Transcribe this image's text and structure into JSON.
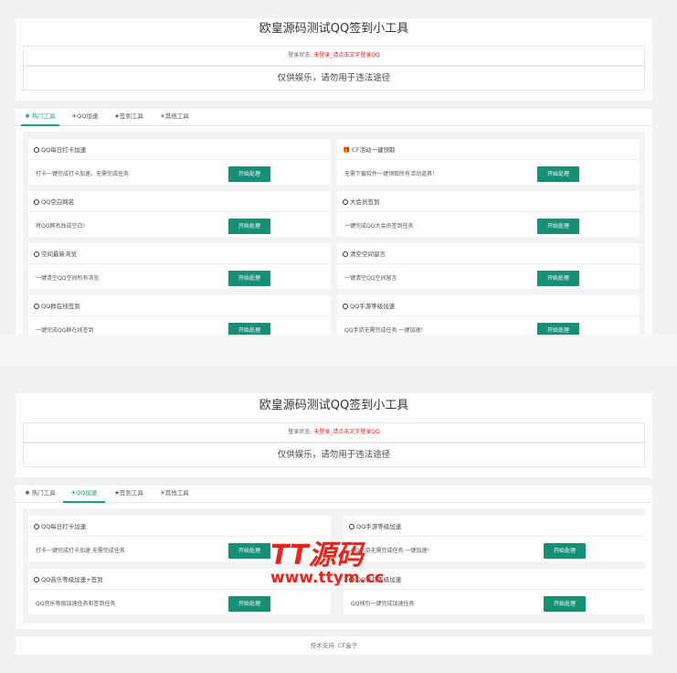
{
  "top": {
    "title": "欧皇源码测试QQ签到小工具",
    "status_prefix": "登录状态:",
    "status_value": "未登录_请点击文字登录QQ",
    "notice": "仅供娱乐，请勿用于违法途径",
    "tabs": [
      "热门工具",
      "QQ加速",
      "签到工具",
      "其他工具"
    ],
    "active_tab": 0,
    "cards": [
      {
        "title": "QQ每日打卡加速",
        "desc": "打卡一键完成打卡加速，无需完成任务",
        "button": "开始处理"
      },
      {
        "title": "CF活动一键领取",
        "desc": "无需下载软件一键领取所有活动道具！",
        "button": "开始处理"
      },
      {
        "title": "QQ空白网名",
        "desc": "将QQ网名改成空白！",
        "button": "开始处理"
      },
      {
        "title": "大会员签到",
        "desc": "一键完成QQ大会员签到任务",
        "button": "开始处理"
      },
      {
        "title": "空间最新浏览",
        "desc": "一键清空QQ空间所有浏览",
        "button": "开始处理"
      },
      {
        "title": "清空空间留言",
        "desc": "一键清空QQ空间留言",
        "button": "开始处理"
      },
      {
        "title": "QQ群在线签到",
        "desc": "一键完成QQ群在线签到",
        "button": "开始处理"
      },
      {
        "title": "QQ手游等级加速",
        "desc": "QQ手游无需完成任务 一键加速！",
        "button": "开始处理"
      }
    ]
  },
  "bottom": {
    "title": "欧皇源码测试QQ签到小工具",
    "status_prefix": "登录状态:",
    "status_value": "未登录_请点击文字登录QQ",
    "notice": "仅供娱乐，请勿用于违法途径",
    "tabs": [
      "热门工具",
      "QQ加速",
      "签到工具",
      "其他工具"
    ],
    "active_tab": 1,
    "cards": [
      {
        "title": "QQ每日打卡加速",
        "desc": "打卡一键完成打卡加速 无需完成任务",
        "button": "开始处理"
      },
      {
        "title": "QQ手游等级加速",
        "desc": "QQ手游无需完成任务 一键加速！",
        "button": "开始处理"
      },
      {
        "title": "QQ音乐等级加速+签到",
        "desc": "QQ音乐等级加速任务和签到任务",
        "button": "开始处理"
      },
      {
        "title": "QQ钱包等级加速",
        "desc": "QQ钱包一键完成加速任务",
        "button": "开始处理"
      }
    ],
    "footer": "技术支持: CF盒子"
  },
  "watermark": {
    "brand": "TT源码",
    "url": "www.ttym.cc",
    "color": "#e8251d"
  },
  "accent": "#168f76"
}
